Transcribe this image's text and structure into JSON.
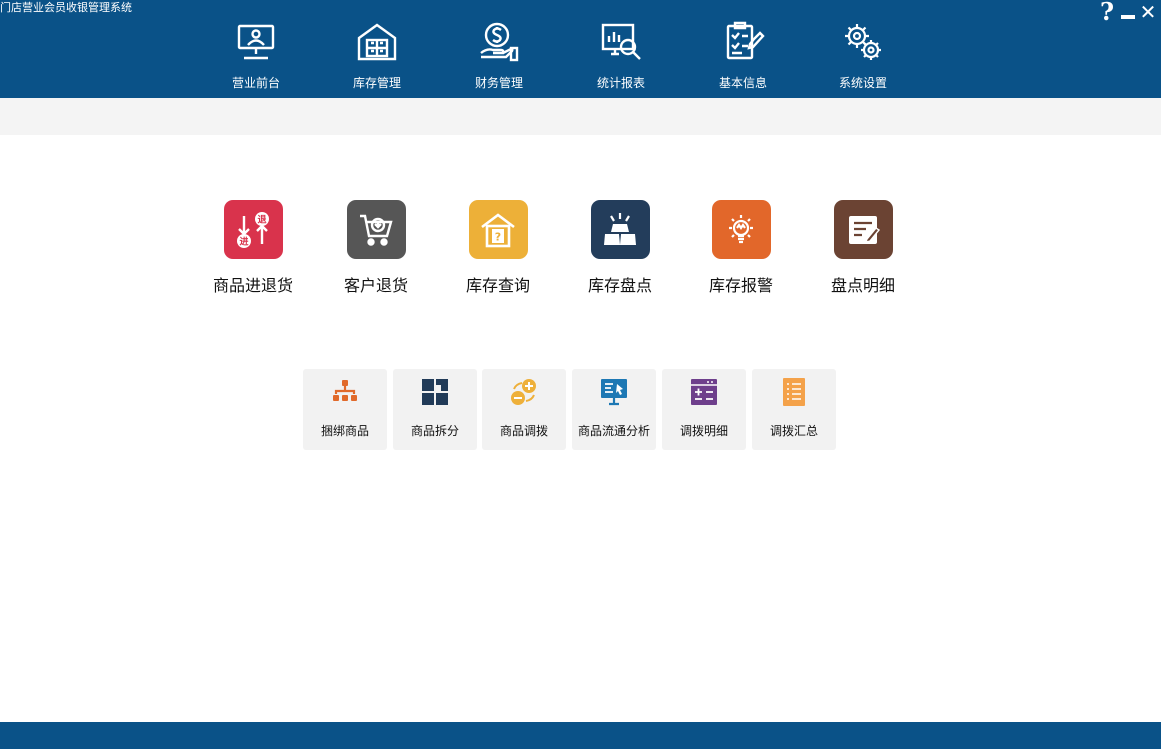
{
  "window": {
    "title": "门店营业会员收银管理系统",
    "help_label": "?",
    "close_label": "✕"
  },
  "nav": {
    "items": [
      {
        "label": "营业前台",
        "icon": "monitor-user-icon"
      },
      {
        "label": "库存管理",
        "icon": "warehouse-icon"
      },
      {
        "label": "财务管理",
        "icon": "money-hand-icon"
      },
      {
        "label": "统计报表",
        "icon": "report-chart-icon"
      },
      {
        "label": "基本信息",
        "icon": "checklist-icon"
      },
      {
        "label": "系统设置",
        "icon": "gears-icon"
      }
    ]
  },
  "tiles": [
    {
      "label": "商品进退货",
      "color": "#d9334c",
      "icon": "in-out-icon"
    },
    {
      "label": "客户退货",
      "color": "#565656",
      "icon": "cart-return-icon"
    },
    {
      "label": "库存查询",
      "color": "#edb038",
      "icon": "house-query-icon"
    },
    {
      "label": "库存盘点",
      "color": "#233d5b",
      "icon": "stock-boxes-icon"
    },
    {
      "label": "库存报警",
      "color": "#e2672a",
      "icon": "alarm-bulb-icon"
    },
    {
      "label": "盘点明细",
      "color": "#6b4333",
      "icon": "note-edit-icon"
    }
  ],
  "subtiles": [
    {
      "label": "捆绑商品",
      "color": "#e16a2b",
      "icon": "bundle-tree-icon"
    },
    {
      "label": "商品拆分",
      "color": "#213b58",
      "icon": "split-blocks-icon"
    },
    {
      "label": "商品调拨",
      "color": "#eeb03a",
      "icon": "transfer-icon"
    },
    {
      "label": "商品流通分析",
      "color": "#1d78b4",
      "icon": "analysis-board-icon"
    },
    {
      "label": "调拨明细",
      "color": "#6e3f8c",
      "icon": "transfer-detail-icon"
    },
    {
      "label": "调拨汇总",
      "color": "#f4a24a",
      "icon": "summary-list-icon"
    }
  ]
}
